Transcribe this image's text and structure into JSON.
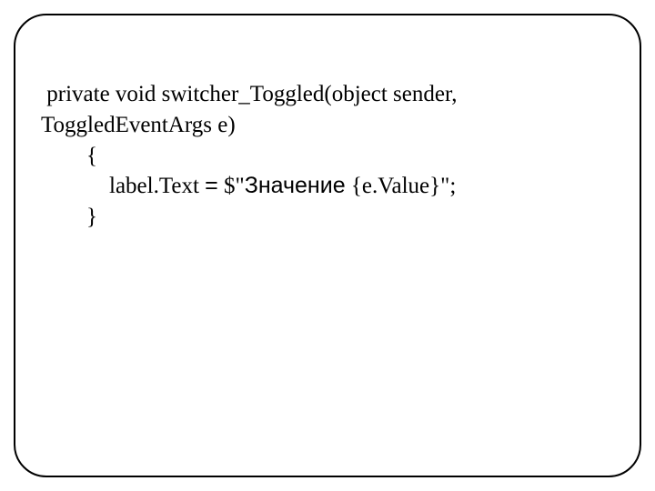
{
  "code": {
    "line1": " private void switcher_Toggled(object sender, ToggledEventArgs e)",
    "line2": "        {",
    "line3_pre": "            label.Text ",
    "line3_eq": "=",
    "line3_post": " $\"",
    "line3_ru": "Значение",
    "line3_end": " {e.Value}\";",
    "line4": "        }"
  }
}
